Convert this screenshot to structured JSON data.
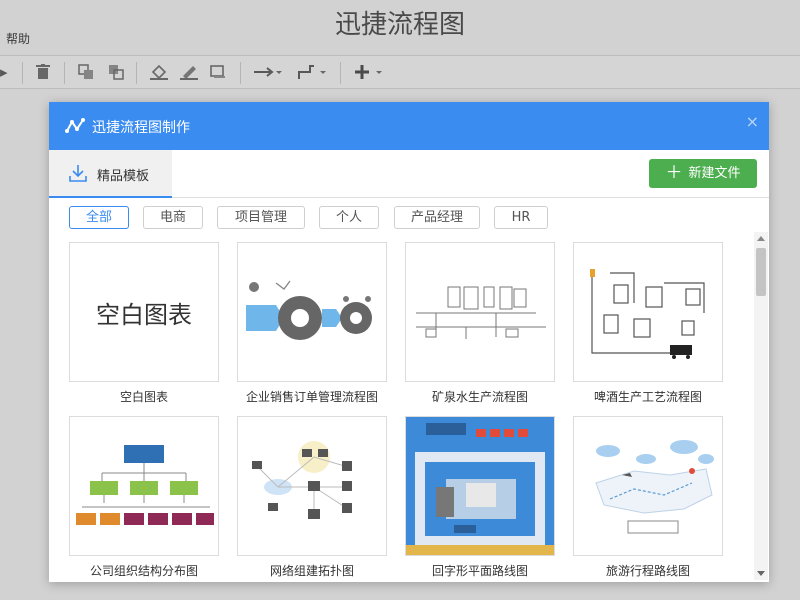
{
  "app": {
    "title": "迅捷流程图",
    "menu_help": "帮助"
  },
  "dialog": {
    "title": "迅捷流程图制作",
    "close": "×",
    "tab_label": "精品模板",
    "new_file_label": "新建文件"
  },
  "filters": [
    {
      "label": "全部",
      "active": true
    },
    {
      "label": "电商",
      "active": false
    },
    {
      "label": "项目管理",
      "active": false
    },
    {
      "label": "个人",
      "active": false
    },
    {
      "label": "产品经理",
      "active": false
    },
    {
      "label": "HR",
      "active": false
    }
  ],
  "templates": [
    {
      "label": "空白图表",
      "thumb_text": "空白图表"
    },
    {
      "label": "企业销售订单管理流程图"
    },
    {
      "label": "矿泉水生产流程图"
    },
    {
      "label": "啤酒生产工艺流程图"
    },
    {
      "label": "公司组织结构分布图"
    },
    {
      "label": "网络组建拓扑图"
    },
    {
      "label": "回字形平面路线图"
    },
    {
      "label": "旅游行程路线图"
    }
  ],
  "colors": {
    "accent": "#3b8cf1",
    "success": "#4cae4f"
  }
}
